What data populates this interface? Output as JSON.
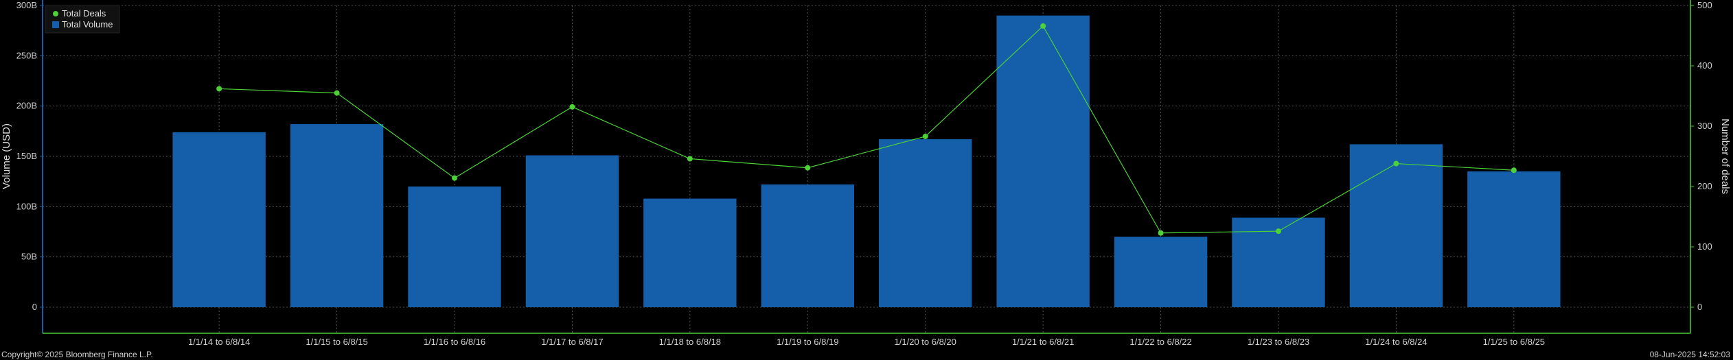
{
  "chart_data": {
    "type": "bar",
    "categories": [
      "1/1/14 to 6/8/14",
      "1/1/15 to 6/8/15",
      "1/1/16 to 6/8/16",
      "1/1/17 to 6/8/17",
      "1/1/18 to 6/8/18",
      "1/1/19 to 6/8/19",
      "1/1/20 to 6/8/20",
      "1/1/21 to 6/8/21",
      "1/1/22 to 6/8/22",
      "1/1/23 to 6/8/23",
      "1/1/24 to 6/8/24",
      "1/1/25 to 6/8/25"
    ],
    "series": [
      {
        "name": "Total Volume",
        "type": "bar",
        "axis": "left",
        "color": "#145eaa",
        "values": [
          174,
          182,
          120,
          151,
          108,
          122,
          167,
          290,
          70,
          89,
          162,
          135
        ]
      },
      {
        "name": "Total Deals",
        "type": "line",
        "axis": "right",
        "color": "#4cd137",
        "values": [
          362,
          355,
          214,
          332,
          246,
          231,
          283,
          466,
          123,
          126,
          238,
          227
        ]
      }
    ],
    "left_axis": {
      "label": "Volume (USD)",
      "min": 0,
      "max": 300,
      "ticks": [
        0,
        50,
        100,
        150,
        200,
        250,
        300
      ],
      "tick_labels": [
        "0",
        "50B",
        "100B",
        "150B",
        "200B",
        "250B",
        "300B"
      ]
    },
    "right_axis": {
      "label": "Number of deals",
      "min": 0,
      "max": 500,
      "ticks": [
        0,
        100,
        200,
        300,
        400,
        500
      ],
      "tick_labels": [
        "0",
        "100",
        "200",
        "300",
        "400",
        "500"
      ]
    },
    "grid": true,
    "legend_position": "top-left",
    "background": "#000000",
    "axis_color": "#4cd137",
    "left_axis_color": "#145eaa"
  },
  "footer": {
    "copyright": "Copyright© 2025 Bloomberg Finance L.P.",
    "timestamp": "08-Jun-2025 14:52:03"
  }
}
